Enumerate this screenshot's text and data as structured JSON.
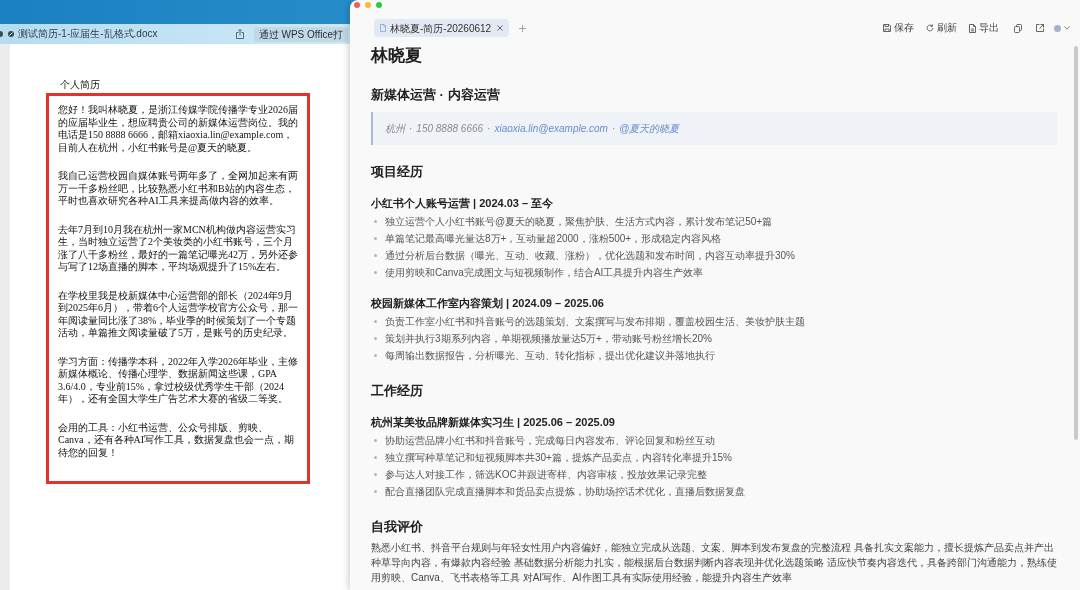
{
  "preview_window": {
    "title": "测试简历-1-应届生-乱格式.docx",
    "open_button": "通过 WPS Office打",
    "document": {
      "heading": "个人简历",
      "highlighted": true,
      "paragraphs": [
        "您好！我叫林晓夏，是浙江传媒学院传播学专业2026届的应届毕业生，想应聘贵公司的新媒体运营岗位。我的电话是150 8888 6666，邮箱xiaoxia.lin@example.com，目前人在杭州，小红书账号是@夏天的晓夏。",
        "我自己运营校园自媒体账号两年多了，全网加起来有两万一千多粉丝吧，比较熟悉小红书和B站的内容生态，平时也喜欢研究各种AI工具来提高做内容的效率。",
        "去年7月到10月我在杭州一家MCN机构做内容运营实习生，当时独立运营了2个美妆类的小红书账号，三个月涨了八千多粉丝，最好的一篇笔记曝光42万，另外还参与写了12场直播的脚本，平均场观提升了15%左右。",
        "在学校里我是校新媒体中心运营部的部长（2024年9月到2025年6月），带着6个人运营学校官方公众号，那一年阅读量同比涨了38%，毕业季的时候策划了一个专题活动，单篇推文阅读量破了5万，是账号的历史纪录。",
        "学习方面：传播学本科，2022年入学2026年毕业，主修新媒体概论、传播心理学、数据新闻这些课，GPA 3.6/4.0，专业前15%，拿过校级优秀学生干部（2024年），还有全国大学生广告艺术大赛的省级二等奖。",
        "会用的工具：小红书运营、公众号排版、剪映、Canva，还有各种AI写作工具，数据复盘也会一点，期待您的回复！"
      ]
    }
  },
  "editor_window": {
    "tabs": [
      {
        "label": "林晓夏-简历-20260612",
        "selected": true
      }
    ],
    "toolbar": [
      "保存",
      "刷新",
      "导出"
    ],
    "document": {
      "name": "林晓夏",
      "subtitle": "新媒体运营 · 内容运营",
      "contact": {
        "separator": "·",
        "items": [
          {
            "kind": "text",
            "text": "杭州"
          },
          {
            "kind": "text",
            "text": "150 8888 6666"
          },
          {
            "kind": "link",
            "text": "xiaoxia.lin@example.com"
          },
          {
            "kind": "link",
            "text": "@夏天的晓夏"
          }
        ]
      },
      "sections": [
        {
          "title": "项目经历",
          "kind": "entries",
          "entries": [
            {
              "heading": "小红书个人账号运营 | 2024.03 – 至今",
              "bullets": [
                "独立运营个人小红书账号@夏天的晓夏，聚焦护肤、生活方式内容，累计发布笔记50+篇",
                "单篇笔记最高曝光量达8万+，互动量超2000，涨粉500+，形成稳定内容风格",
                "通过分析后台数据（曝光、互动、收藏、涨粉），优化选题和发布时间，内容互动率提升30%",
                "使用剪映和Canva完成图文与短视频制作，结合AI工具提升内容生产效率"
              ]
            },
            {
              "heading": "校园新媒体工作室内容策划 | 2024.09 – 2025.06",
              "bullets": [
                "负责工作室小红书和抖音账号的选题策划、文案撰写与发布排期，覆盖校园生活、美妆护肤主题",
                "策划并执行3期系列内容，单期视频播放量达5万+，带动账号粉丝增长20%",
                "每周输出数据报告，分析曝光、互动、转化指标，提出优化建议并落地执行"
              ]
            }
          ]
        },
        {
          "title": "工作经历",
          "kind": "entries",
          "entries": [
            {
              "heading": "杭州某美妆品牌新媒体实习生 | 2025.06 – 2025.09",
              "bullets": [
                "协助运营品牌小红书和抖音账号，完成每日内容发布、评论回复和粉丝互动",
                "独立撰写种草笔记和短视频脚本共30+篇，提炼产品卖点，内容转化率提升15%",
                "参与达人对接工作，筛选KOC并跟进寄样、内容审核，投放效果记录完整",
                "配合直播团队完成直播脚本和货品卖点提炼，协助场控话术优化，直播后数据复盘"
              ]
            }
          ]
        },
        {
          "title": "自我评价",
          "kind": "paragraph",
          "text": "熟悉小红书、抖音平台规则与年轻女性用户内容偏好，能独立完成从选题、文案、脚本到发布复盘的完整流程 具备扎实文案能力，擅长提炼产品卖点并产出种草导向内容，有爆款内容经验 基础数据分析能力扎实，能根据后台数据判断内容表现并优化选题策略 适应快节奏内容迭代，具备跨部门沟通能力，熟练使用剪映、Canva、飞书表格等工具 对AI写作、AI作图工具有实际使用经验，能提升内容生产效率"
        }
      ]
    }
  }
}
